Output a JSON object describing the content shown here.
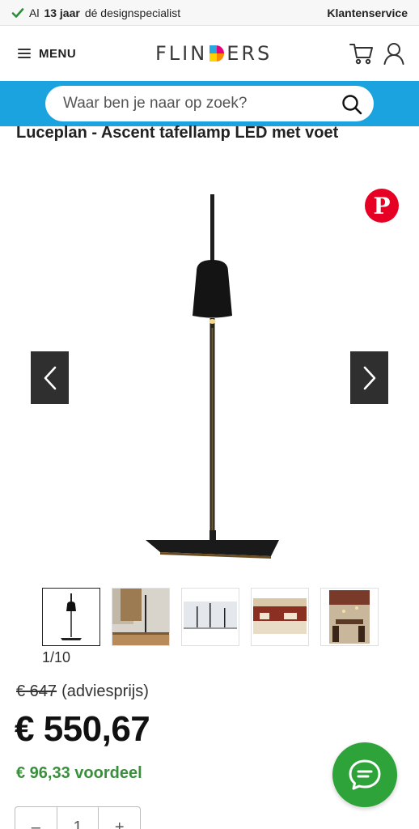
{
  "topbar": {
    "usp_prefix": "Al",
    "usp_bold": "13 jaar",
    "usp_suffix": "dé designspecialist",
    "service": "Klantenservice"
  },
  "header": {
    "menu_label": "MENU",
    "logo_left": "FLIN",
    "logo_right": "ERS"
  },
  "search": {
    "placeholder": "Waar ben je naar op zoek?"
  },
  "product": {
    "title": "Luceplan - Ascent tafellamp LED met voet",
    "counter": "1/10",
    "old_price": "€ 647",
    "old_price_note": "(adviesprijs)",
    "price": "€ 550,67",
    "saving": "€ 96,33 voordeel",
    "quantity": "1",
    "qty_minus": "–",
    "qty_plus": "+"
  },
  "icons": {
    "pinterest": "P"
  },
  "colors": {
    "brand_blue": "#1aa3df",
    "saving_green": "#3a8f3c",
    "chat_green": "#2ea33a",
    "pinterest_red": "#e60023"
  }
}
